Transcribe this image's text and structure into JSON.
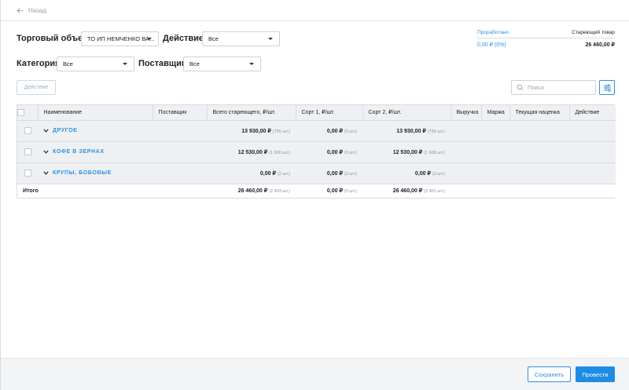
{
  "nav": {
    "back_label": "Назад"
  },
  "filters": {
    "store_label": "Торговый объект",
    "store_value": "ТО ИП НЕМЧЕНКО ВА...",
    "action_label": "Действие",
    "action_value": "Все",
    "category_label": "Категория",
    "category_value": "Все",
    "supplier_label": "Поставщик",
    "supplier_value": "Все"
  },
  "stats": {
    "processed_label": "Проработано",
    "processed_value": "0,00 ₽ (0%)",
    "processed_fraction": 0,
    "stale_label": "Стареющий товар",
    "stale_value": "26 460,00 ₽"
  },
  "toolbar": {
    "action_button": "Действие",
    "search_placeholder": "Поиск"
  },
  "table": {
    "columns": [
      "Наименование",
      "Поставщик",
      "Всего стареющего, ₽/шт.",
      "Сорт 1, ₽/шт.",
      "Сорт 2, ₽/шт.",
      "Выручка",
      "Маржа",
      "Текущая наценка",
      "Действие"
    ],
    "groups": [
      {
        "name": "ДРУГОЕ",
        "total": "13 930,00 ₽",
        "total_qty": "(795 шт.)",
        "sort1": "0,00 ₽",
        "sort1_qty": "(0 шт.)",
        "sort2": "13 930,00 ₽",
        "sort2_qty": "(795 шт.)"
      },
      {
        "name": "КОФЕ В ЗЕРНАХ",
        "total": "12 530,00 ₽",
        "total_qty": "(1 606 шт.)",
        "sort1": "0,00 ₽",
        "sort1_qty": "(0 шт.)",
        "sort2": "12 530,00 ₽",
        "sort2_qty": "(1 606 шт.)"
      },
      {
        "name": "КРУПЫ, БОБОВЫЕ",
        "total": "0,00 ₽",
        "total_qty": "(2 шт.)",
        "sort1": "0,00 ₽",
        "sort1_qty": "(2 шт.)",
        "sort2": "0,00 ₽",
        "sort2_qty": "(2 шт.)"
      }
    ],
    "totals": {
      "label": "Итого",
      "total": "26 460,00 ₽",
      "total_qty": "(2 403 шт.)",
      "sort1": "0,00 ₽",
      "sort1_qty": "(0 шт.)",
      "sort2": "26 460,00 ₽",
      "sort2_qty": "(2 401 шт.)"
    }
  },
  "footer": {
    "save_label": "Сохранить",
    "post_label": "Провести"
  },
  "colors": {
    "accent": "#1e8ce3",
    "header_bg": "#eef0f3",
    "border": "#d7dbe0"
  }
}
